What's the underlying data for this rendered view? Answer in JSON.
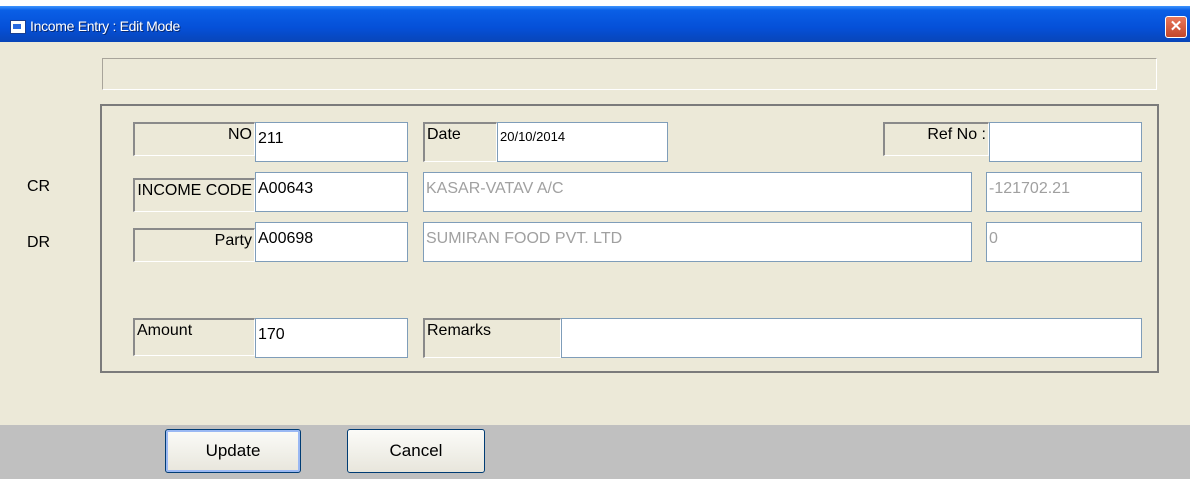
{
  "window": {
    "title": "Income Entry : Edit Mode",
    "close_glyph": "✕",
    "icon": "app-window-icon"
  },
  "side_labels": {
    "cr": "CR",
    "dr": "DR"
  },
  "form": {
    "no_label": "NO",
    "no_value": "211",
    "date_label": "Date",
    "date_value": "20/10/2014",
    "ref_label": "Ref No :",
    "ref_value": "",
    "income_code_label": "INCOME CODE",
    "income_code_value": "A00643",
    "income_name": "KASAR-VATAV A/C",
    "income_balance": "-121702.21",
    "party_label": "Party",
    "party_value": "A00698",
    "party_name": "SUMIRAN FOOD PVT. LTD",
    "party_balance": "0",
    "amount_label": "Amount",
    "amount_value": "170",
    "remarks_label": "Remarks",
    "remarks_value": ""
  },
  "buttons": {
    "update": "Update",
    "cancel": "Cancel"
  },
  "colors": {
    "titlebar": "#0550d8",
    "dialog_bg": "#ece9d8",
    "bottom_bar": "#c0c0c0",
    "close": "#c2462a"
  }
}
